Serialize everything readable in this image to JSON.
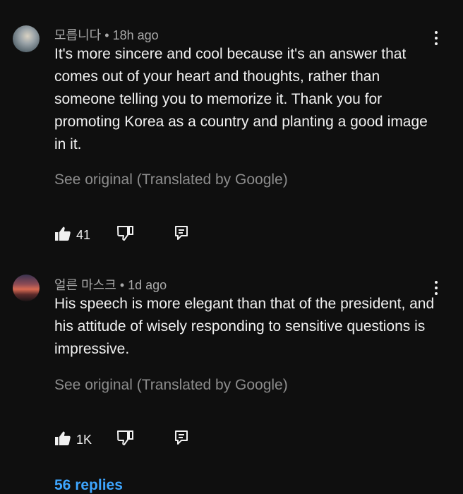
{
  "comments": [
    {
      "author": "모릅니다",
      "time": "18h ago",
      "text": "It's more sincere and cool because it's an answer that comes out of your heart and thoughts, rather than someone telling you to memorize it. Thank you for promoting Korea as a country and planting a good image in it.",
      "see_original": "See original (Translated by Google)",
      "likes": "41"
    },
    {
      "author": "얼른 마스크",
      "time": "1d ago",
      "text": "His speech is more elegant than that of the president, and his attitude of wisely responding to sensitive questions is impressive.",
      "see_original": "See original (Translated by Google)",
      "likes": "1K"
    }
  ],
  "replies_label": "56 replies",
  "colors": {
    "background": "#0f0f0f",
    "text": "#f1f1f1",
    "meta": "#aaaaaa",
    "muted": "#8c8c8c",
    "link": "#3ea6ff"
  }
}
